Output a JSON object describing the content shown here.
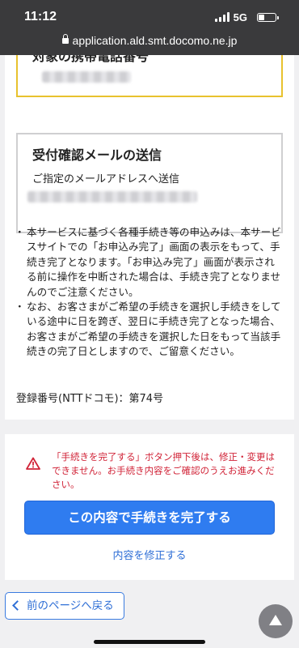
{
  "status_bar": {
    "time": "11:12",
    "network": "5G"
  },
  "browser": {
    "url": "application.ald.smt.docomo.ne.jp"
  },
  "phone_section": {
    "title": "対象の携帯電話番号"
  },
  "email_section": {
    "title": "受付確認メールの送信",
    "subtitle": "ご指定のメールアドレスへ送信"
  },
  "notes": [
    "本サービスに基づく各種手続き等の申込みは、本サービスサイトでの「お申込み完了」画面の表示をもって、手続き完了となります。「お申込み完了」画面が表示される前に操作を中断された場合は、手続き完了となりませんのでご注意ください。",
    "なお、お客さまがご希望の手続きを選択し手続きをしている途中に日を跨ぎ、翌日に手続き完了となった場合、お客さまがご希望の手続きを選択した日をもって当該手続きの完了日としますので、ご留意ください。"
  ],
  "registration": "登録番号(NTTドコモ)：第74号",
  "warning": "「手続きを完了する」ボタン押下後は、修正・変更はできません。お手続き内容をご確認のうえお進みください。",
  "buttons": {
    "complete": "この内容で手続きを完了する",
    "modify": "内容を修正する",
    "back": "前のページへ戻る"
  },
  "colors": {
    "accent": "#2f7cf0",
    "warning": "#d12438",
    "highlight_border": "#e8c22e"
  }
}
